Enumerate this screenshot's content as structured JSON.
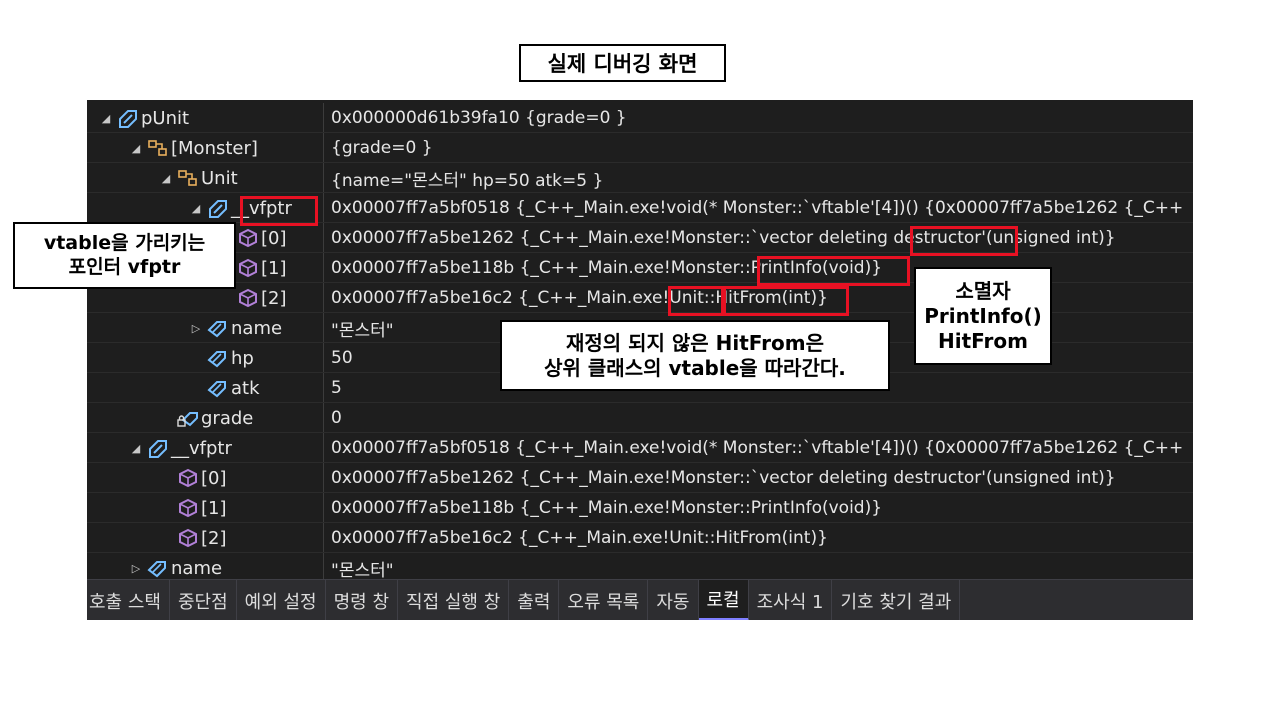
{
  "title": "실제 디버깅 화면",
  "colors": {
    "panel_bg": "#1e1e1e",
    "highlight": "#e81123",
    "class_icon": "#b180d7",
    "pointer_icon": "#75beff"
  },
  "rows": [
    {
      "expander": "◢",
      "icon": "pointer-icon",
      "name": "pUnit",
      "value": "0x000000d61b39fa10 {grade=0 }"
    },
    {
      "expander": "◢",
      "icon": "base-class-icon",
      "name": "[Monster]",
      "value": "{grade=0 }"
    },
    {
      "expander": "◢",
      "icon": "base-class-icon",
      "name": "Unit",
      "value": "{name=\"몬스터\" hp=50 atk=5 }"
    },
    {
      "expander": "◢",
      "icon": "pointer-icon",
      "name": "__vfptr",
      "value": "0x00007ff7a5bf0518 {_C++_Main.exe!void(* Monster::`vftable'[4])() {0x00007ff7a5be1262 {_C++"
    },
    {
      "expander": "",
      "icon": "method-icon",
      "name": "[0]",
      "value": "0x00007ff7a5be1262 {_C++_Main.exe!Monster::`vector deleting destructor'(unsigned int)}"
    },
    {
      "expander": "",
      "icon": "method-icon",
      "name": "[1]",
      "value": "0x00007ff7a5be118b {_C++_Main.exe!Monster::PrintInfo(void)}"
    },
    {
      "expander": "",
      "icon": "method-icon",
      "name": "[2]",
      "value": "0x00007ff7a5be16c2 {_C++_Main.exe!Unit::HitFrom(int)}"
    },
    {
      "expander": "▷",
      "icon": "field-icon",
      "name": "name",
      "value": "\"몬스터\""
    },
    {
      "expander": "",
      "icon": "field-icon",
      "name": "hp",
      "value": "50"
    },
    {
      "expander": "",
      "icon": "field-icon",
      "name": "atk",
      "value": "5"
    },
    {
      "expander": "",
      "icon": "field-lock-icon",
      "name": "grade",
      "value": "0"
    },
    {
      "expander": "◢",
      "icon": "pointer-icon",
      "name": "__vfptr",
      "value": "0x00007ff7a5bf0518 {_C++_Main.exe!void(* Monster::`vftable'[4])() {0x00007ff7a5be1262 {_C++"
    },
    {
      "expander": "",
      "icon": "method-icon",
      "name": "[0]",
      "value": "0x00007ff7a5be1262 {_C++_Main.exe!Monster::`vector deleting destructor'(unsigned int)}"
    },
    {
      "expander": "",
      "icon": "method-icon",
      "name": "[1]",
      "value": "0x00007ff7a5be118b {_C++_Main.exe!Monster::PrintInfo(void)}"
    },
    {
      "expander": "",
      "icon": "method-icon",
      "name": "[2]",
      "value": "0x00007ff7a5be16c2 {_C++_Main.exe!Unit::HitFrom(int)}"
    },
    {
      "expander": "▷",
      "icon": "field-icon",
      "name": "name",
      "value": "\"몬스터\""
    }
  ],
  "tabs": [
    {
      "label": "호출 스택",
      "active": false
    },
    {
      "label": "중단점",
      "active": false
    },
    {
      "label": "예외 설정",
      "active": false
    },
    {
      "label": "명령 창",
      "active": false
    },
    {
      "label": "직접 실행 창",
      "active": false
    },
    {
      "label": "출력",
      "active": false
    },
    {
      "label": "오류 목록",
      "active": false
    },
    {
      "label": "자동",
      "active": false
    },
    {
      "label": "로컬",
      "active": true
    },
    {
      "label": "조사식 1",
      "active": false
    },
    {
      "label": "기호 찾기 결과",
      "active": false
    }
  ],
  "callouts": {
    "vfptr_note": {
      "line1": "vtable을 가리키는",
      "line2": "포인터 vfptr"
    },
    "funcs_note": {
      "line1": "소멸자",
      "line2": "PrintInfo()",
      "line3": "HitFrom"
    },
    "hitfrom_note": {
      "line1": "재정의 되지 않은 HitFrom은",
      "line2": "상위 클래스의 vtable을 따라간다."
    }
  }
}
